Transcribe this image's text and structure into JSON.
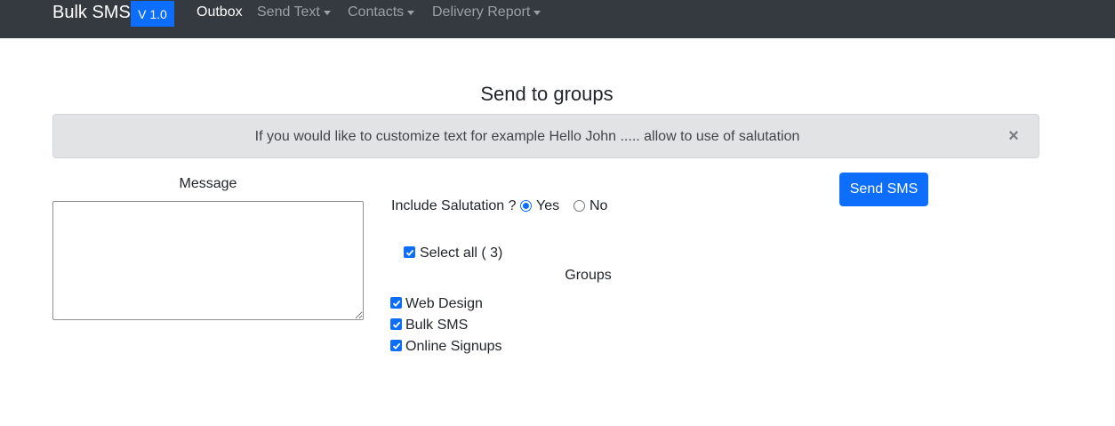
{
  "navbar": {
    "brand": "Bulk SMS",
    "version": "V 1.0",
    "links": [
      {
        "label": "Outbox"
      },
      {
        "label": "Send Text"
      },
      {
        "label": "Contacts"
      },
      {
        "label": "Delivery Report"
      }
    ]
  },
  "page": {
    "title": "Send to groups"
  },
  "alert": {
    "text": "If you would like to customize text for example Hello John ..... allow to use of salutation",
    "close_icon": "×"
  },
  "form": {
    "message_label": "Message",
    "message_value": "",
    "salutation_label": "Include Salutation ?",
    "salutation_options": [
      {
        "label": "Yes",
        "checked": true
      },
      {
        "label": "No",
        "checked": false
      }
    ],
    "send_button": "Send SMS",
    "select_all_label": "Select all ( 3)",
    "select_all_checked": true,
    "groups_label": "Groups",
    "groups": [
      {
        "label": "Web Design",
        "checked": true
      },
      {
        "label": "Bulk SMS",
        "checked": true
      },
      {
        "label": "Online Signups",
        "checked": true
      }
    ]
  },
  "colors": {
    "navbar_bg": "#343a40",
    "primary": "#0d6efd",
    "alert_bg": "#e2e3e5"
  }
}
